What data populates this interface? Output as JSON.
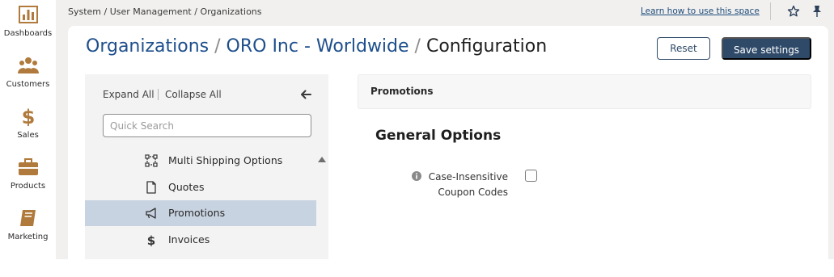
{
  "app_nav": [
    {
      "label": "Dashboards",
      "icon": "bar-chart-icon"
    },
    {
      "label": "Customers",
      "icon": "users-icon"
    },
    {
      "label": "Sales",
      "icon": "dollar-icon"
    },
    {
      "label": "Products",
      "icon": "briefcase-icon"
    },
    {
      "label": "Marketing",
      "icon": "book-icon"
    }
  ],
  "header": {
    "breadcrumb": "System / User Management / Organizations",
    "learn_link": "Learn how to use this space"
  },
  "title": {
    "part1": "Organizations",
    "sep1": "/",
    "part2": "ORO Inc - Worldwide",
    "sep2": "/",
    "part3": "Configuration"
  },
  "actions": {
    "reset": "Reset",
    "save": "Save settings"
  },
  "tree": {
    "expand_all": "Expand All",
    "collapse_all": "Collapse All",
    "search_placeholder": "Quick Search",
    "items": [
      {
        "label": "Multi Shipping Options",
        "icon": "multi-shipping-icon"
      },
      {
        "label": "Quotes",
        "icon": "document-icon"
      },
      {
        "label": "Promotions",
        "icon": "megaphone-icon",
        "active": true
      },
      {
        "label": "Invoices",
        "icon": "dollar-icon"
      }
    ]
  },
  "section": {
    "header": "Promotions",
    "group_title": "General Options",
    "field_label": "Case-Insensitive Coupon Codes",
    "field_checked": false
  },
  "colors": {
    "accent": "#2f4a69",
    "title_link": "#1e4f8c",
    "nav_icon": "#b07a3c",
    "active_item": "#c8d3e1"
  }
}
